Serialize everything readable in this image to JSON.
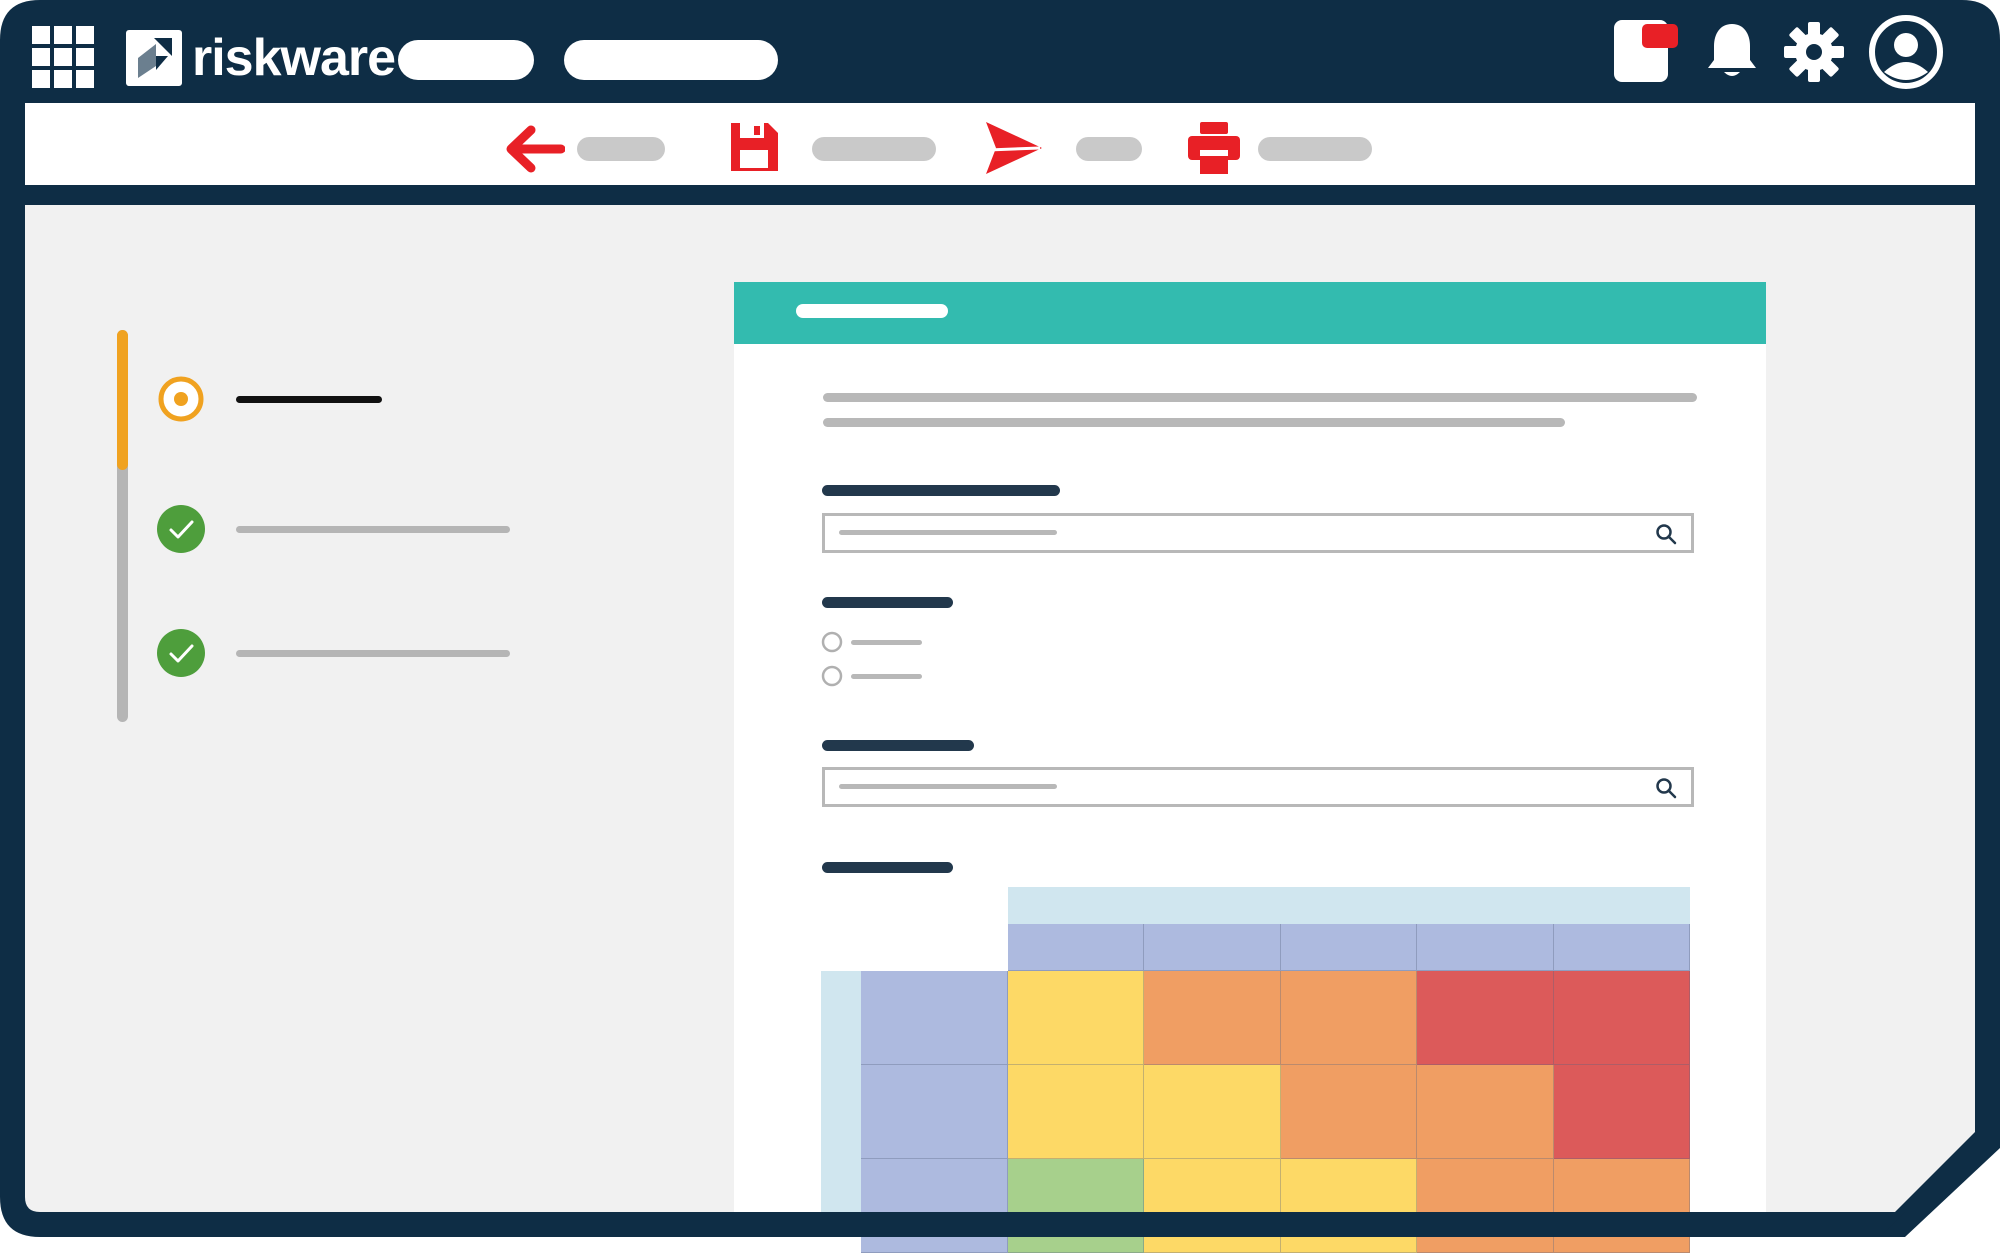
{
  "app": {
    "brand": "riskware"
  },
  "colors": {
    "navy": "#0e2d45",
    "teal": "#33bbaf",
    "accent_red": "#e82026",
    "orange": "#f0a220",
    "green": "#4e9e3c",
    "matrix_header_light": "#d0e6ef",
    "matrix_header": "#adbadf",
    "risk_yellow": "#fdd966",
    "risk_orange": "#f09e63",
    "risk_red": "#dc5a5a",
    "risk_green": "#a7d08c"
  },
  "icons": {
    "apps": "apps-grid-icon",
    "notifications": "bell-icon",
    "settings": "gear-icon",
    "profile": "user-avatar-icon",
    "chat": "chat-badge-icon",
    "back": "arrow-left-icon",
    "save": "save-icon",
    "send": "send-icon",
    "print": "print-icon",
    "search": "search-icon",
    "step_current": "radio-current-icon",
    "step_done": "check-circle-icon"
  },
  "steps": [
    {
      "state": "current"
    },
    {
      "state": "complete"
    },
    {
      "state": "complete"
    }
  ],
  "matrix": {
    "rows": [
      [
        "yellow",
        "orange",
        "orange",
        "red",
        "red"
      ],
      [
        "yellow",
        "yellow",
        "orange",
        "orange",
        "red"
      ],
      [
        "green",
        "yellow",
        "yellow",
        "orange",
        "orange"
      ]
    ]
  }
}
